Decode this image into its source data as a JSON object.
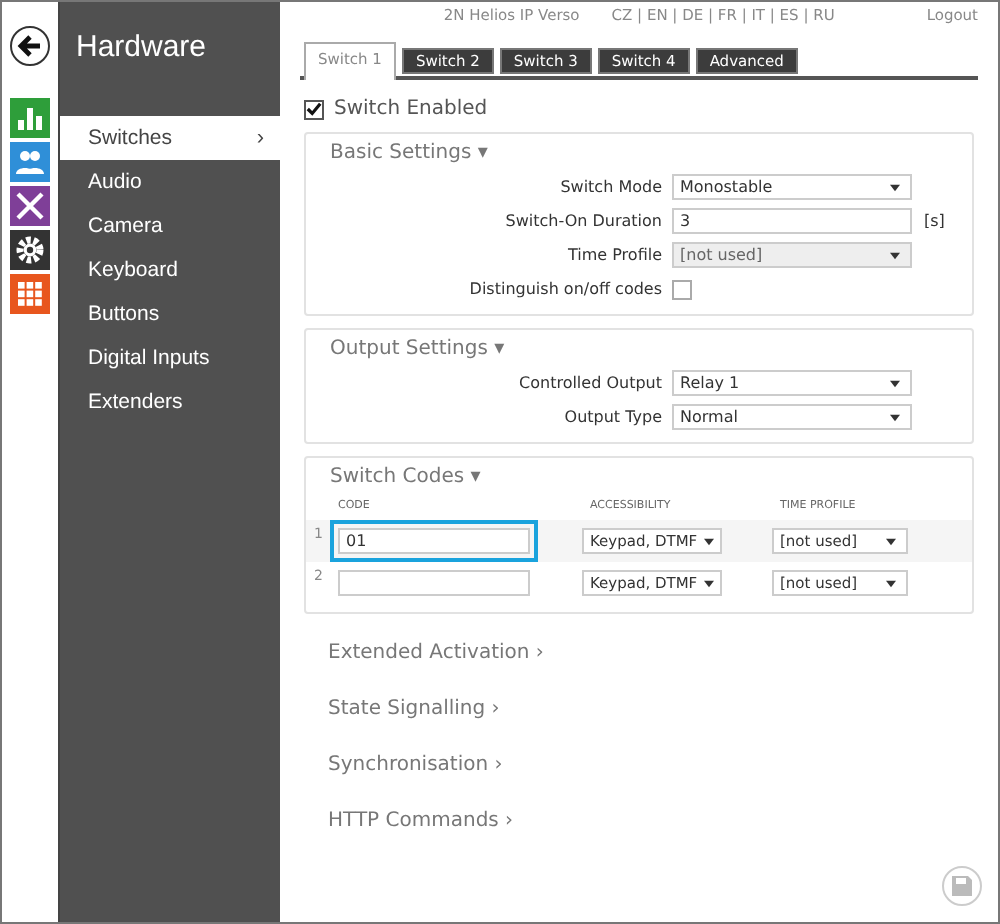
{
  "header": {
    "device": "2N Helios IP Verso",
    "languages": "CZ | EN | DE | FR | IT | ES | RU",
    "logout": "Logout"
  },
  "sidebar": {
    "title": "Hardware",
    "items": [
      {
        "label": "Switches",
        "selected": true,
        "arrow": "›"
      },
      {
        "label": "Audio",
        "selected": false
      },
      {
        "label": "Camera",
        "selected": false
      },
      {
        "label": "Keyboard",
        "selected": false
      },
      {
        "label": "Buttons",
        "selected": false
      },
      {
        "label": "Digital Inputs",
        "selected": false
      },
      {
        "label": "Extenders",
        "selected": false
      }
    ]
  },
  "apps": [
    {
      "kind": "chart",
      "color": "#2e9e3a"
    },
    {
      "kind": "users",
      "color": "#2f8fd8"
    },
    {
      "kind": "tools",
      "color": "#7f3f98"
    },
    {
      "kind": "gear",
      "color": "#333333"
    },
    {
      "kind": "grid",
      "color": "#e8561e"
    }
  ],
  "tabs": [
    {
      "label": "Switch 1",
      "selected": true
    },
    {
      "label": "Switch 2",
      "selected": false
    },
    {
      "label": "Switch 3",
      "selected": false
    },
    {
      "label": "Switch 4",
      "selected": false
    },
    {
      "label": "Advanced",
      "selected": false
    }
  ],
  "switch_enabled": {
    "label": "Switch Enabled",
    "checked": true
  },
  "sections": [
    {
      "kind": "fields",
      "title": "Basic Settings ▾",
      "rows": [
        {
          "label": "Switch Mode",
          "kind": "select",
          "value": "Monostable",
          "disabled": false
        },
        {
          "label": "Switch-On Duration",
          "kind": "input",
          "value": "3",
          "unit": "[s]"
        },
        {
          "label": "Time Profile",
          "kind": "select",
          "value": "[not used]",
          "disabled": true
        },
        {
          "label": "Distinguish on/off codes",
          "kind": "checkbox",
          "checked": false
        }
      ]
    },
    {
      "kind": "fields",
      "title": "Output Settings ▾",
      "rows": [
        {
          "label": "Controlled Output",
          "kind": "select",
          "value": "Relay 1",
          "disabled": false
        },
        {
          "label": "Output Type",
          "kind": "select",
          "value": "Normal",
          "disabled": false
        }
      ]
    },
    {
      "kind": "codes",
      "title": "Switch Codes ▾",
      "columns": [
        "CODE",
        "ACCESSIBILITY",
        "TIME PROFILE"
      ],
      "rows": [
        {
          "index": "1",
          "code": "01",
          "access": "Keypad, DTMF",
          "profile": "[not used]",
          "selected": true
        },
        {
          "index": "2",
          "code": "",
          "access": "Keypad, DTMF",
          "profile": "[not used]",
          "selected": false
        }
      ]
    },
    {
      "kind": "collapsed",
      "title": "Extended Activation ›"
    },
    {
      "kind": "collapsed",
      "title": "State Signalling ›"
    },
    {
      "kind": "collapsed",
      "title": "Synchronisation ›"
    },
    {
      "kind": "collapsed",
      "title": "HTTP Commands ›"
    }
  ]
}
